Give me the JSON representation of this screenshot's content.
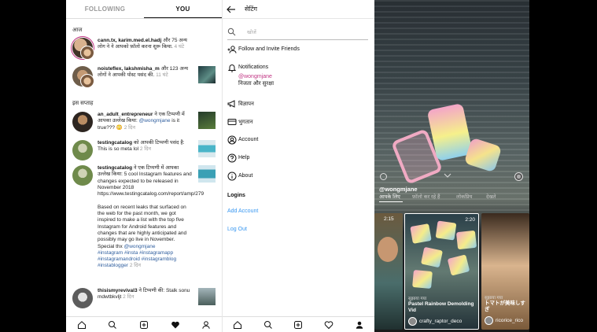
{
  "activity": {
    "tabs": [
      "FOLLOWING",
      "YOU"
    ],
    "section_today": "आज",
    "section_week": "इस सप्ताह",
    "items": [
      {
        "user": "cann.tx, karim.med.el.hadj",
        "text": " और 75 अन्य लोग ने ने आपको फ़ॉलो करना शुरू किया.",
        "time": " 4 घंटे"
      },
      {
        "user": "noisteflex, lakshmisha_m",
        "text": " और 123 अन्य लोगों ने आपकी पोस्ट पसंद की.",
        "time": " 11 घंटे"
      },
      {
        "user": "an_adult_entrepreneur",
        "text": " ने एक टिप्पणी में आपका उल्लेख किया: ",
        "mention": "@wongmjane",
        "text2": " is it true??? 😳",
        "time": " 2 दिन"
      },
      {
        "user": "testingcatalog",
        "text": " को आपकी टिप्पणी पसंद है: This is so meta lol",
        "time": " 2 दिन"
      },
      {
        "user": "testingcatalog",
        "text": " ने एक टिप्पणी में आपका उल्लेख किया: 5 cool Instagram features and changes expected to be released in November 2018 https://www.testingcatalog.com/report/amp/279",
        "body": "Based on recent leaks that surfaced on the web for the past month, we got inspired to make a list with the top five Instagram for Android features and changes that are highly anticipated and possibly may go live in November. Special thx ",
        "mention": "@wongmjane",
        "tags": "#instagram #insta #instagramapp #instagramandroid #instagramblog #instablogger",
        "time": " 2 दिन"
      },
      {
        "user": "thisismyrevival3",
        "text": " ने टिप्पणी की: Stalk sonu mdwtbkvljt",
        "time": " 2 दिन"
      }
    ]
  },
  "settings": {
    "title": "सेटिंग",
    "search_placeholder": "खोजें",
    "rows": {
      "follow": "Follow and Invite Friends",
      "notifications": "Notifications",
      "notif_handle": "@wongmjane",
      "privacy": "निजता और सुरक्षा",
      "ads": "विज्ञापन",
      "payments": "भुगतान",
      "account": "Account",
      "help": "Help",
      "about": "About"
    },
    "logins": "Logins",
    "add_account": "Add Account",
    "log_out": "Log Out"
  },
  "igtv": {
    "handle": "@wongmjane",
    "tabs": [
      "आपके लिए",
      "फ़ॉलो कर रहे हैं",
      "लोकप्रिय",
      "देखते"
    ],
    "cards": [
      {
        "duration": "2:15"
      },
      {
        "duration": "2:20",
        "sub": "सुझाया गया",
        "title": "Pastel Rainbow Demolding Vid",
        "user": "crafty_raptor_deco"
      },
      {
        "sub": "सुझाया गया",
        "title": "トマトが美味しすぎ",
        "user": "ricorice_rico"
      }
    ]
  }
}
